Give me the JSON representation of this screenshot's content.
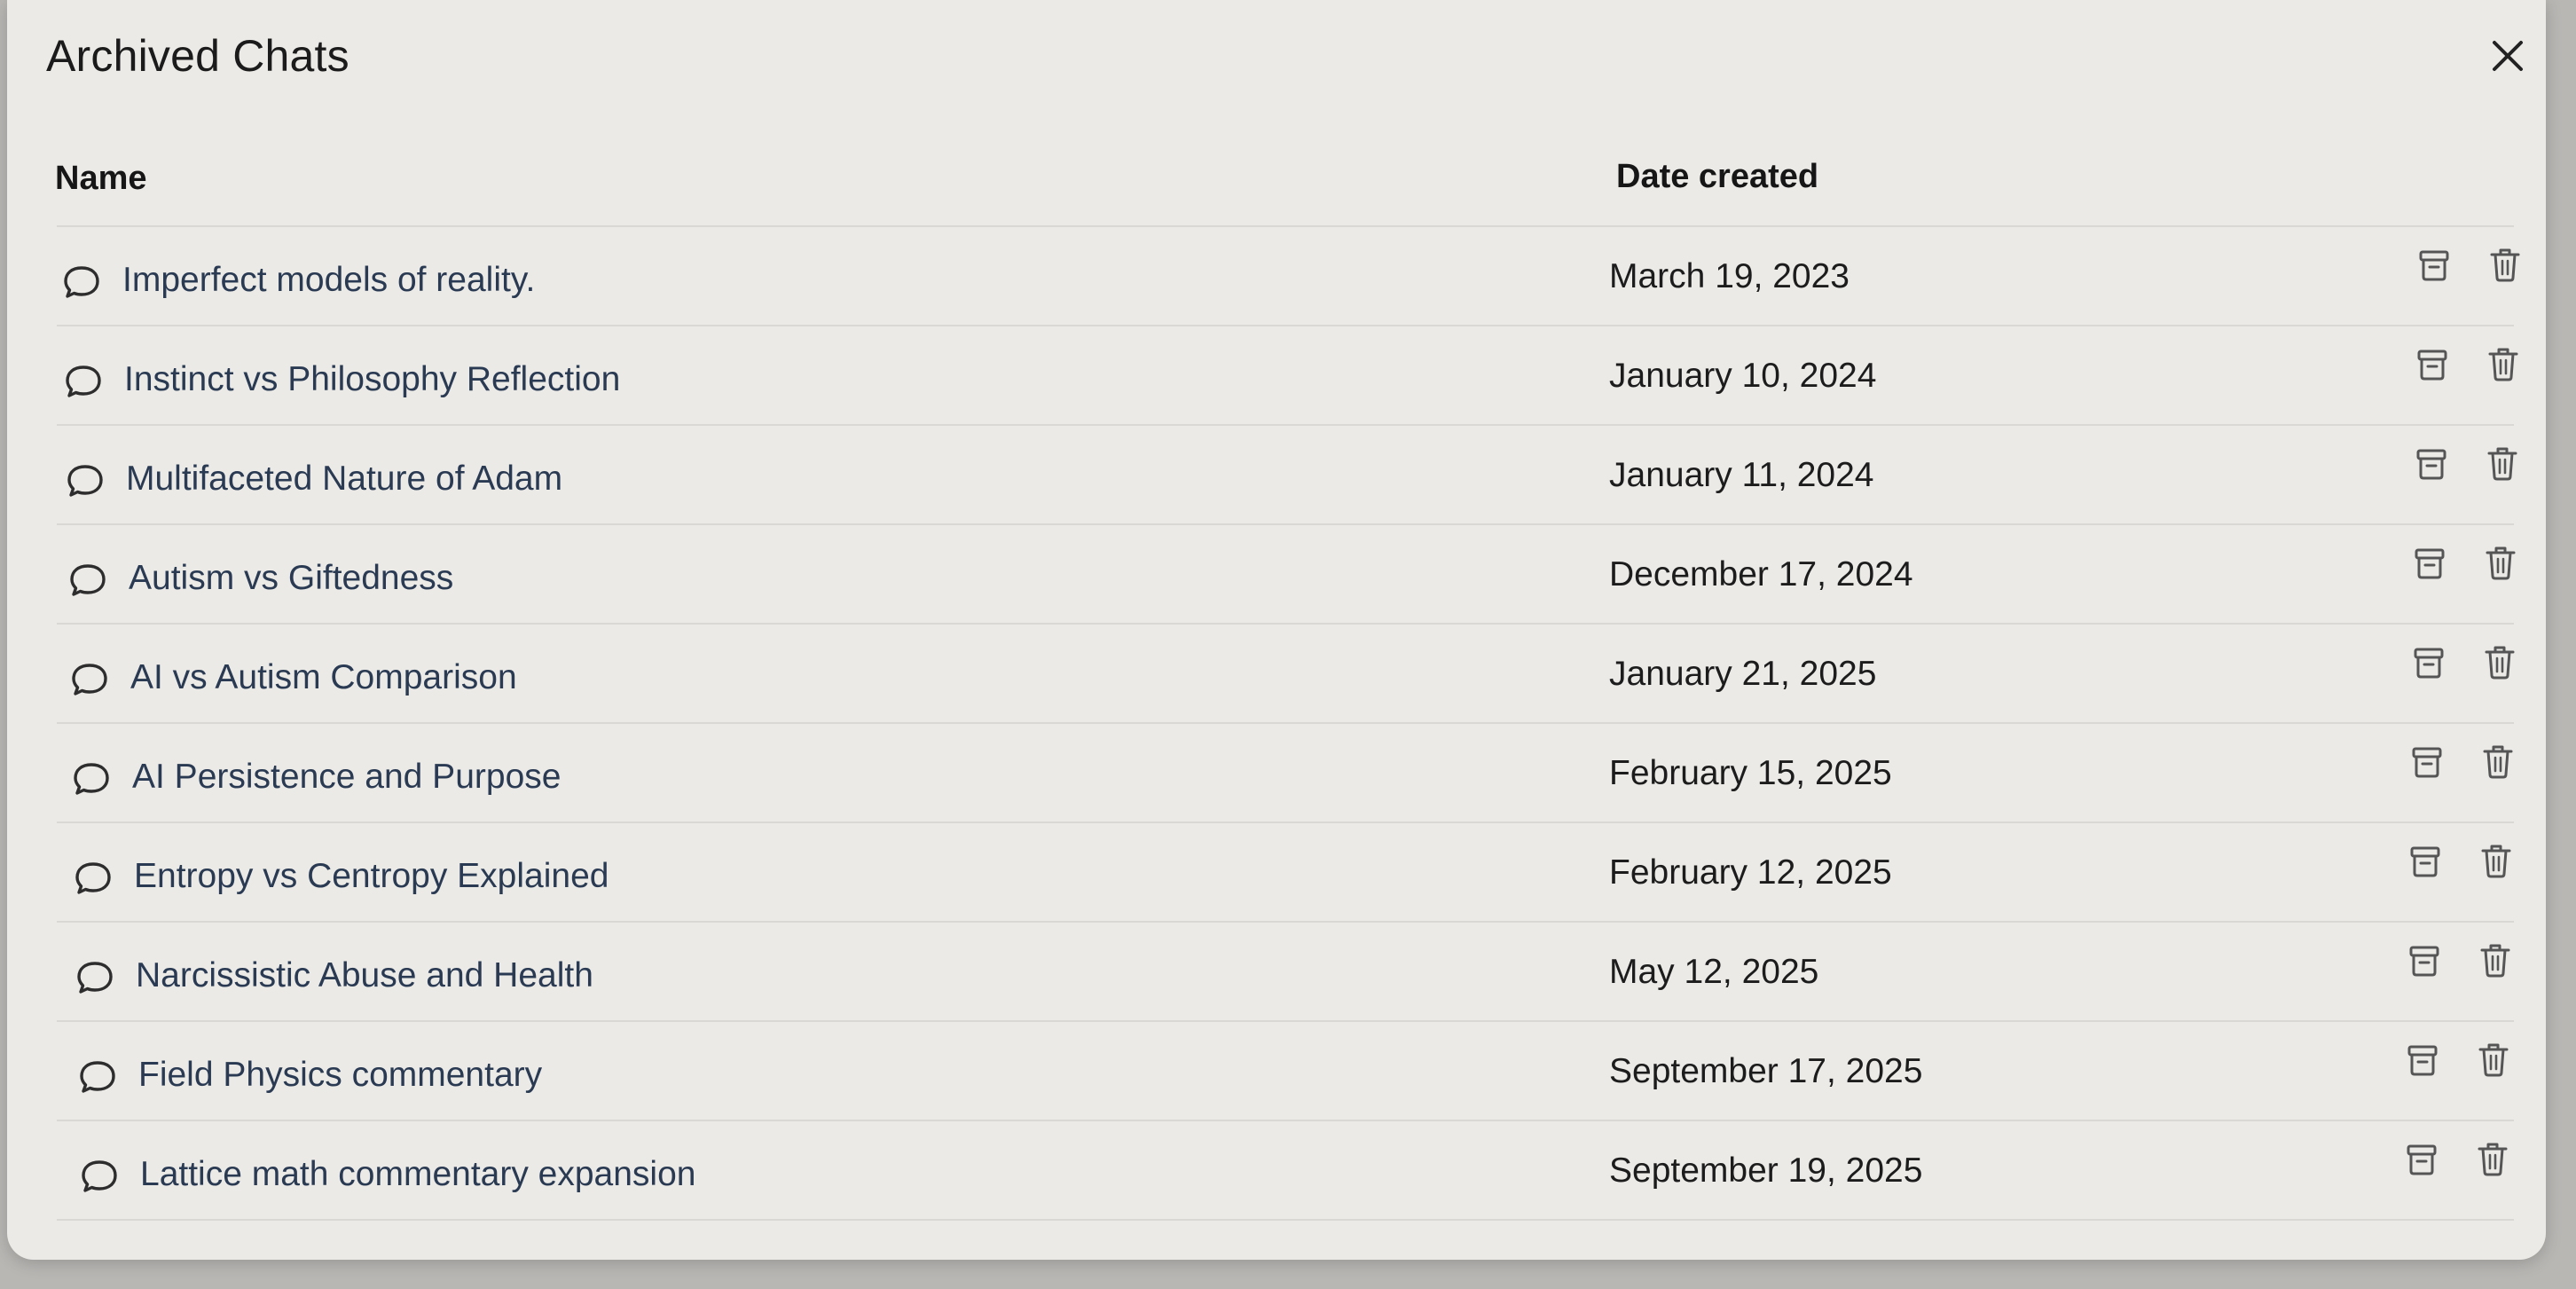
{
  "dialog": {
    "title": "Archived Chats"
  },
  "table": {
    "headers": {
      "name": "Name",
      "date": "Date created"
    },
    "rows": [
      {
        "title": "Imperfect models of reality.",
        "date": "March 19, 2023"
      },
      {
        "title": "Instinct vs Philosophy Reflection",
        "date": "January 10, 2024"
      },
      {
        "title": "Multifaceted Nature of Adam",
        "date": "January 11, 2024"
      },
      {
        "title": "Autism vs Giftedness",
        "date": "December 17, 2024"
      },
      {
        "title": "AI vs Autism Comparison",
        "date": "January 21, 2025"
      },
      {
        "title": "AI Persistence and Purpose",
        "date": "February 15, 2025"
      },
      {
        "title": "Entropy vs Centropy Explained",
        "date": "February 12, 2025"
      },
      {
        "title": "Narcissistic Abuse and Health",
        "date": "May 12, 2025"
      },
      {
        "title": "Field Physics commentary",
        "date": "September 17, 2025"
      },
      {
        "title": "Lattice math commentary expansion",
        "date": "September 19, 2025"
      }
    ]
  },
  "icons": {
    "row_leading": "chat-bubble-icon",
    "unarchive": "unarchive-icon",
    "delete": "trash-icon",
    "close": "close-icon"
  },
  "colors": {
    "background": "#ebeae7",
    "title_text": "#2a3a52",
    "date_text": "#1c1c1c",
    "icon": "#5a5a5a"
  }
}
